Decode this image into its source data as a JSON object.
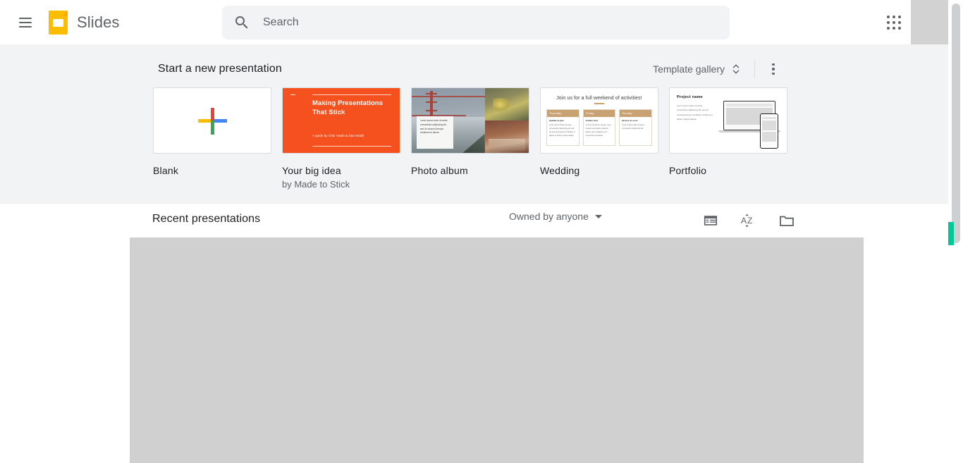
{
  "header": {
    "menu_icon": "hamburger-menu-icon",
    "logo_icon": "google-slides-logo-icon",
    "product_name": "Slides",
    "search": {
      "icon": "search-icon",
      "value": "",
      "placeholder": "Search"
    },
    "apps_icon": "google-apps-grid-icon",
    "avatar": "account-avatar"
  },
  "template_section": {
    "title": "Start a new presentation",
    "gallery_button": {
      "label": "Template gallery",
      "icon": "expand-collapse-chevrons-icon"
    },
    "more_menu_icon": "more-options-kebab-icon",
    "templates": [
      {
        "name": "Blank",
        "subtitle": "",
        "thumb": "blank-plus-thumbnail"
      },
      {
        "name": "Your big idea",
        "subtitle": "by Made to Stick",
        "thumb": "big-idea-thumbnail",
        "slide_title": "Making Presentations That Stick",
        "slide_credit": "A guide by Chip Heath & Dan Heath",
        "accent_color": "#f4511e"
      },
      {
        "name": "Photo album",
        "subtitle": "",
        "thumb": "photo-album-thumbnail",
        "caption_text": "Lorem ipsum dolor sit amet, consectetur adipiscing elit, sed do eiusmod tempor incididunt ut labore."
      },
      {
        "name": "Wedding",
        "subtitle": "",
        "thumb": "wedding-thumbnail",
        "slide_title": "Join us for a full weekend of activities!",
        "columns": [
          {
            "day": "Thursday",
            "heading": "Sparkle & gem",
            "body": "Lorem ipsum dolor sit amet, consectetur adipiscing elit, sed do eiusmod tempor incididunt ut labore et dolore magna aliqua."
          },
          {
            "day": "Friday",
            "heading": "Golden hour",
            "body": "Ut enim ad minim veniam, quis nostrud exercitation ullamco laboris nisi ut aliquip ex ea commodo consequat."
          },
          {
            "day": "Sunday",
            "heading": "Brunch at noon",
            "body": "Lorem ipsum dolor sit amet, consectetur adipiscing elit."
          }
        ],
        "accent_color": "#c9a273"
      },
      {
        "name": "Portfolio",
        "subtitle": "",
        "thumb": "portfolio-thumbnail",
        "slide_title": "Project name",
        "slide_body": "Lorem ipsum dolor sit amet, consectetur adipiscing elit, sed do eiusmod tempor incididunt ut labore et dolore magna aliqua."
      }
    ]
  },
  "recent_section": {
    "title": "Recent presentations",
    "owner_filter": {
      "label": "Owned by anyone",
      "icon": "caret-down-icon"
    },
    "view_list_icon": "list-view-icon",
    "sort_icon": "sort-az-icon",
    "folder_icon": "open-file-picker-folder-icon",
    "content_placeholder": "recent-files-grid-placeholder"
  },
  "colors": {
    "brand_yellow": "#fbbc04",
    "section_background": "#f1f3f4",
    "text_primary": "#202124",
    "text_secondary": "#5f6368",
    "scroll_marker_green": "#00c999"
  }
}
